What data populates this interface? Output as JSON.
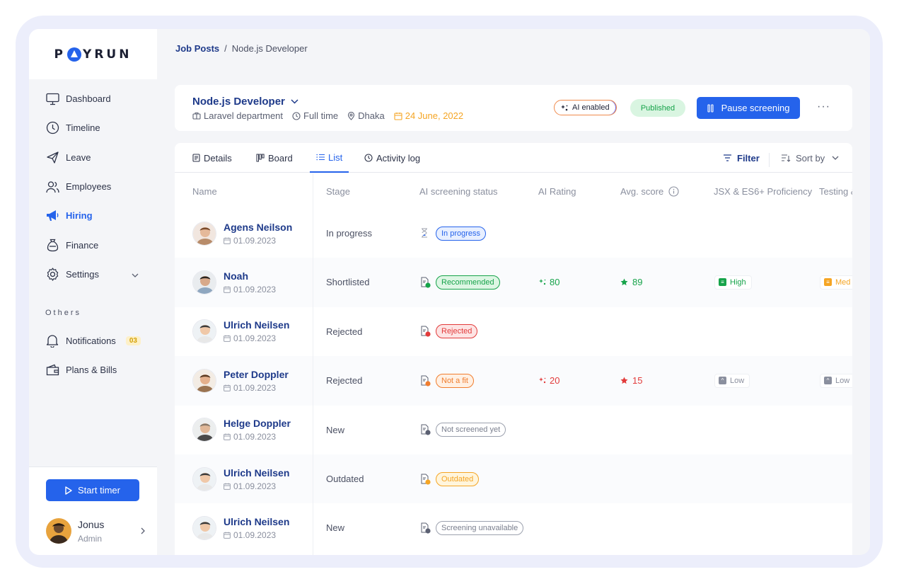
{
  "brand": {
    "logo_left": "P",
    "logo_right": "YRUN"
  },
  "sidebar": {
    "items": [
      {
        "label": "Dashboard",
        "icon": "monitor-icon"
      },
      {
        "label": "Timeline",
        "icon": "clock-icon"
      },
      {
        "label": "Leave",
        "icon": "plane-icon"
      },
      {
        "label": "Employees",
        "icon": "users-icon"
      },
      {
        "label": "Hiring",
        "icon": "megaphone-icon",
        "active": true
      },
      {
        "label": "Finance",
        "icon": "money-bag-icon"
      },
      {
        "label": "Settings",
        "icon": "gear-icon"
      }
    ],
    "others_label": "Others",
    "others": [
      {
        "label": "Notifications",
        "icon": "bell-icon",
        "badge": "03"
      },
      {
        "label": "Plans & Bills",
        "icon": "wallet-icon"
      }
    ],
    "start_timer": "Start timer",
    "user": {
      "name": "Jonus",
      "role": "Admin"
    }
  },
  "breadcrumb": {
    "root": "Job Posts",
    "separator": "/",
    "current": "Node.js Developer"
  },
  "job": {
    "title": "Node.js Developer",
    "department": "Laravel department",
    "type": "Full time",
    "location": "Dhaka",
    "date": "24 June, 2022",
    "ai_label": "AI enabled",
    "status": "Published",
    "pause_label": "Pause screening",
    "more": "···"
  },
  "tabs": [
    {
      "label": "Details",
      "icon": "document-icon"
    },
    {
      "label": "Board",
      "icon": "board-icon"
    },
    {
      "label": "List",
      "icon": "list-icon",
      "active": true
    },
    {
      "label": "Activity log",
      "icon": "clock-icon"
    }
  ],
  "toolbar": {
    "filter": "Filter",
    "sort": "Sort by"
  },
  "columns": [
    "Name",
    "Stage",
    "AI screening status",
    "AI Rating",
    "Avg. score",
    "JSX & ES6+ Proficiency",
    "Testing &"
  ],
  "rows": [
    {
      "name": "Agens Neilson",
      "date": "01.09.2023",
      "stage": "In progress",
      "status": "In progress",
      "status_kind": "progress",
      "rating": "",
      "avg": "",
      "prof": "",
      "testing": ""
    },
    {
      "name": "Noah",
      "date": "01.09.2023",
      "stage": "Shortlisted",
      "status": "Recommended",
      "status_kind": "recommended",
      "rating": "80",
      "avg": "89",
      "prof": "High",
      "testing": "Med"
    },
    {
      "name": "Ulrich Neilsen",
      "date": "01.09.2023",
      "stage": "Rejected",
      "status": "Rejected",
      "status_kind": "rejected",
      "rating": "",
      "avg": "",
      "prof": "",
      "testing": ""
    },
    {
      "name": "Peter Doppler",
      "date": "01.09.2023",
      "stage": "Rejected",
      "status": "Not a fit",
      "status_kind": "notfit",
      "rating": "20",
      "avg": "15",
      "prof": "Low",
      "testing": "Low"
    },
    {
      "name": "Helge Doppler",
      "date": "01.09.2023",
      "stage": "New",
      "status": "Not screened yet",
      "status_kind": "notscreened",
      "rating": "",
      "avg": "",
      "prof": "",
      "testing": ""
    },
    {
      "name": "Ulrich Neilsen",
      "date": "01.09.2023",
      "stage": "Outdated",
      "status": "Outdated",
      "status_kind": "outdated",
      "rating": "",
      "avg": "",
      "prof": "",
      "testing": ""
    },
    {
      "name": "Ulrich Neilsen",
      "date": "01.09.2023",
      "stage": "New",
      "status": "Screening unavailable",
      "status_kind": "unavail",
      "rating": "",
      "avg": "",
      "prof": "",
      "testing": ""
    }
  ],
  "colors": {
    "accent": "#2563eb",
    "navy": "#1e3a8a",
    "success": "#16a34a",
    "danger": "#e23b3b",
    "warning": "#f5a524"
  }
}
